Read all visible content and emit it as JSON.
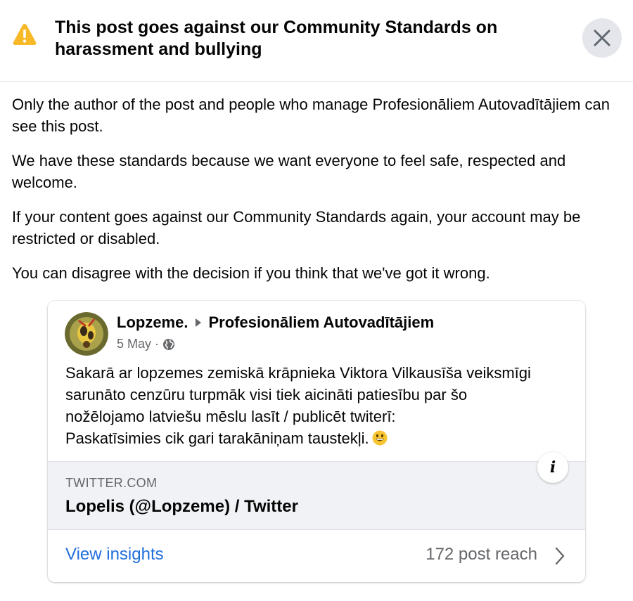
{
  "dialog": {
    "title": "This post goes against our Community Standards on harassment and bullying",
    "warning_icon": "warning-triangle-icon",
    "close_icon": "close-icon"
  },
  "body": {
    "paragraphs": [
      "Only the author of the post and people who manage Profesionāliem Autovadītājiem can see this post.",
      "We have these standards because we want everyone to feel safe, respected and welcome.",
      "If your content goes against our Community Standards again, your account may be restricted or disabled.",
      "You can disagree with the decision if you think that we've got it wrong."
    ]
  },
  "post": {
    "author": "Lopzeme.",
    "group": "Profesionāliem Autovadītājiem",
    "date": "5 May",
    "separator": "·",
    "privacy_icon": "globe-icon",
    "text_lines": [
      "Sakarā ar lopzemes zemiskā krāpnieka Viktora Vilkausīša veiksmīgi",
      "sarunāto cenzūru turpmāk visi tiek aicināti patiesību par šo",
      "nožēlojamo latviešu mēslu lasīt / publicēt twiterī:",
      "Paskatīsimies cik gari tarakāniņam taustekļi."
    ],
    "emoji": "grinning-face-emoji",
    "link": {
      "domain": "TWITTER.COM",
      "title": "Lopelis (@Lopzeme) / Twitter"
    },
    "info_icon": "i",
    "footer": {
      "insights_label": "View insights",
      "reach_text": "172 post reach",
      "chevron_icon": "chevron-right-icon"
    }
  },
  "colors": {
    "accent": "#216fdb",
    "warning": "#f7b928",
    "muted": "#65676b"
  }
}
